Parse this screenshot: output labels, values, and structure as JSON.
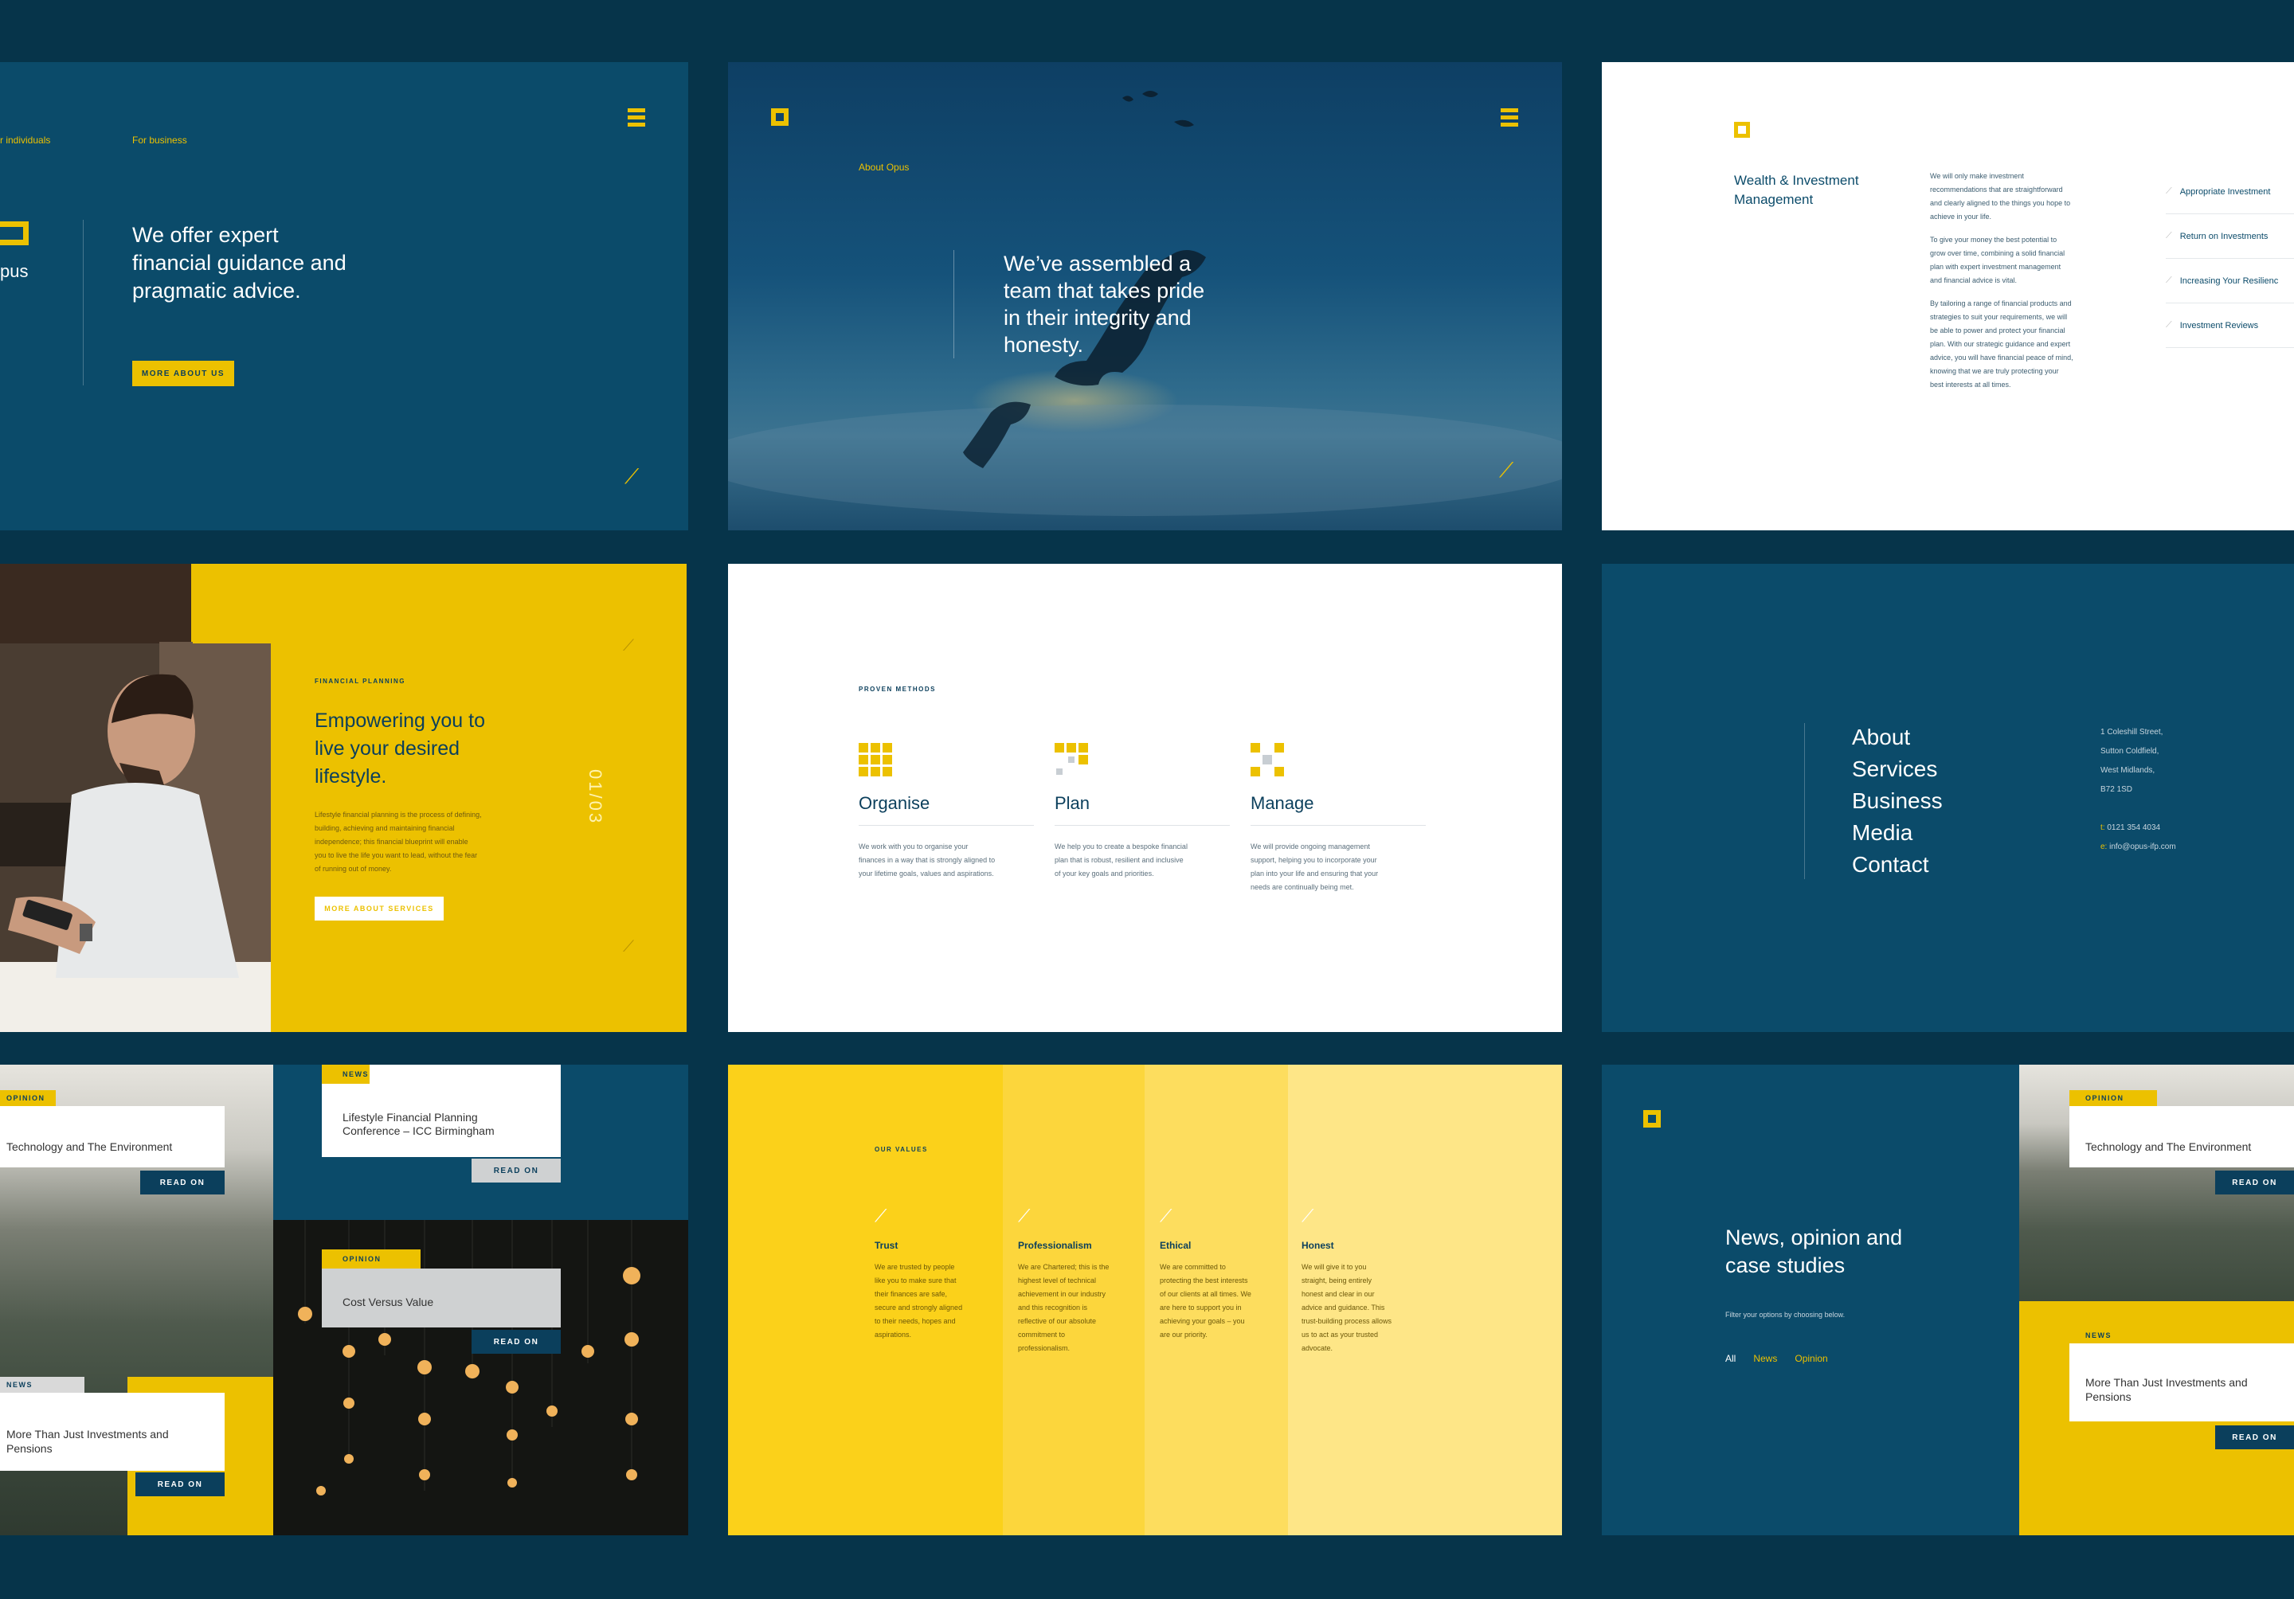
{
  "colors": {
    "background": "#06344a",
    "teal": "#0b4b6a",
    "yellow": "#ecc100",
    "white": "#ffffff"
  },
  "p1": {
    "nav_individuals": "r individuals",
    "nav_business": "For business",
    "logo_text": "pus",
    "headline_1": "We offer expert",
    "headline_2": "financial guidance and",
    "headline_3": "pragmatic advice.",
    "button": "MORE ABOUT US"
  },
  "p2": {
    "label": "About Opus",
    "headline_1": "We’ve assembled a",
    "headline_2": "team that takes pride",
    "headline_3": "in their integrity and",
    "headline_4": "honesty."
  },
  "p3": {
    "title_1": "Wealth & Investment",
    "title_2": "Management",
    "para1": [
      "We will only make investment",
      "recommendations that are straightforward",
      "and clearly aligned to the things you hope to",
      "achieve in your life."
    ],
    "para2": [
      "To give your money the best potential to",
      "grow over time, combining a solid financial",
      "plan with expert investment management",
      "and financial advice is vital."
    ],
    "para3": [
      "By tailoring a range of financial products and",
      "strategies to suit your requirements, we will",
      "be able to power and protect your financial",
      "plan. With our strategic guidance and expert",
      "advice, you will have financial peace of mind,",
      "knowing that we are truly protecting your",
      "best interests at all times."
    ],
    "links": [
      "Appropriate Investment",
      "Return on Investments",
      "Increasing Your Resilienc",
      "Investment Reviews"
    ]
  },
  "p4": {
    "label": "FINANCIAL PLANNING",
    "headline_1": "Empowering you to",
    "headline_2": "live your desired",
    "headline_3": "lifestyle.",
    "body": [
      "Lifestyle financial planning is the process of defining,",
      "building, achieving and maintaining financial",
      "independence; this financial blueprint will enable",
      "you to live the life you want to lead, without the fear",
      "of running out of money."
    ],
    "button": "MORE ABOUT SERVICES",
    "counter": "01/03"
  },
  "p5": {
    "label": "PROVEN METHODS",
    "cols": [
      {
        "title": "Organise",
        "icon": "grid-icon",
        "body": [
          "We work with you to organise your",
          "finances in a way that is strongly aligned to",
          "your lifetime goals, values and aspirations."
        ]
      },
      {
        "title": "Plan",
        "icon": "plan-icon",
        "body": [
          "We help you to create a bespoke financial",
          "plan that is robust, resilient and inclusive",
          "of your key goals and priorities."
        ]
      },
      {
        "title": "Manage",
        "icon": "manage-icon",
        "body": [
          "We will provide ongoing management",
          "support, helping you to incorporate your",
          "plan into your life and ensuring that your",
          "needs are continually being met."
        ]
      }
    ]
  },
  "p6": {
    "menu": [
      "About",
      "Services",
      "Business",
      "Media",
      "Contact"
    ],
    "address": [
      "1 Coleshill Street,",
      "Sutton Coldfield,",
      "West Midlands,",
      "B72 1SD"
    ],
    "phone_label": "t:",
    "phone": "0121 354 4034",
    "email_label": "e:",
    "email": "info@opus-ifp.com"
  },
  "p7": {
    "card1_tag": "OPINION",
    "card1_title": "Technology and The Environment",
    "card1_btn": "READ ON",
    "card2_tag": "NEWS",
    "card2_title_1": "Lifestyle Financial Planning",
    "card2_title_2": "Conference – ICC Birmingham",
    "card2_btn": "READ ON",
    "card3_tag": "OPINION",
    "card3_title": "Cost Versus Value",
    "card3_btn": "READ ON",
    "card4_tag": "NEWS",
    "card4_title_1": "More Than Just Investments and",
    "card4_title_2": "Pensions",
    "card4_btn": "READ ON"
  },
  "p8": {
    "label": "OUR VALUES",
    "values": [
      {
        "title": "Trust",
        "body": [
          "We are trusted by people",
          "like you to make sure that",
          "their finances are safe,",
          "secure and strongly aligned",
          "to their needs, hopes and",
          "aspirations."
        ]
      },
      {
        "title": "Professionalism",
        "body": [
          "We are Chartered; this is the",
          "highest level of technical",
          "achievement in our industry",
          "and this recognition is",
          "reflective of our absolute",
          "commitment to",
          "professionalism."
        ]
      },
      {
        "title": "Ethical",
        "body": [
          "We are committed to",
          "protecting the best interests",
          "of our clients at all times. We",
          "are here to support you in",
          "achieving your goals – you",
          "are our priority."
        ]
      },
      {
        "title": "Honest",
        "body": [
          "We will give it to you",
          "straight, being entirely",
          "honest and clear in our",
          "advice and guidance. This",
          "trust-building process allows",
          "us to act as your trusted",
          "advocate."
        ]
      }
    ]
  },
  "p9": {
    "headline_1": "News, opinion and",
    "headline_2": "case studies",
    "filter_text": "Filter your options by choosing below.",
    "filters": [
      "All",
      "News",
      "Opinion"
    ],
    "card1_tag": "OPINION",
    "card1_title": "Technology and The Environment",
    "card1_btn": "READ ON",
    "card2_tag": "NEWS",
    "card2_title_1": "More Than Just Investments and",
    "card2_title_2": "Pensions",
    "card2_btn": "READ ON"
  }
}
